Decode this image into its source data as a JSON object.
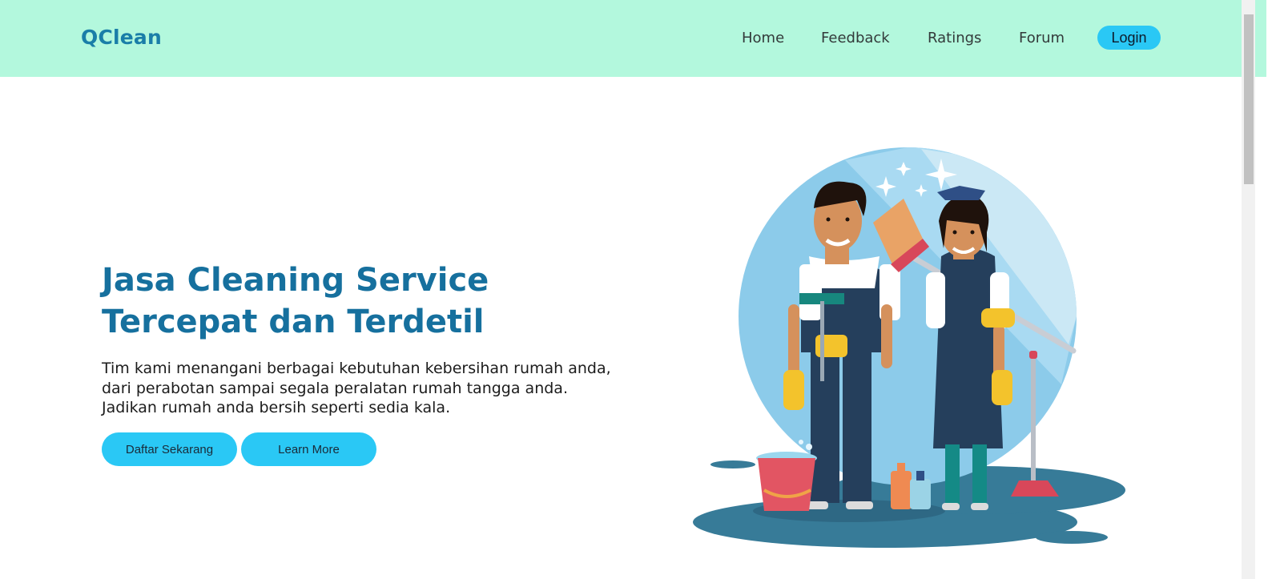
{
  "brand": {
    "name": "QClean"
  },
  "nav": {
    "items": [
      {
        "label": "Home"
      },
      {
        "label": "Feedback"
      },
      {
        "label": "Ratings"
      },
      {
        "label": "Forum"
      }
    ],
    "login_label": "Login"
  },
  "hero": {
    "title_line1": "Jasa Cleaning Service",
    "title_line2": "Tercepat dan Terdetil",
    "description": "Tim kami menangani berbagai kebutuhan kebersihan rumah anda, dari perabotan sampai segala peralatan rumah tangga anda. Jadikan rumah anda bersih seperti sedia kala.",
    "primary_button": "Daftar Sekarang",
    "secondary_button": "Learn More",
    "illustration_icon": "cleaning-staff-illustration"
  },
  "colors": {
    "navbar_bg": "#b3f8dd",
    "brand": "#1a7ea8",
    "title": "#16709e",
    "button": "#2ac8f5"
  }
}
